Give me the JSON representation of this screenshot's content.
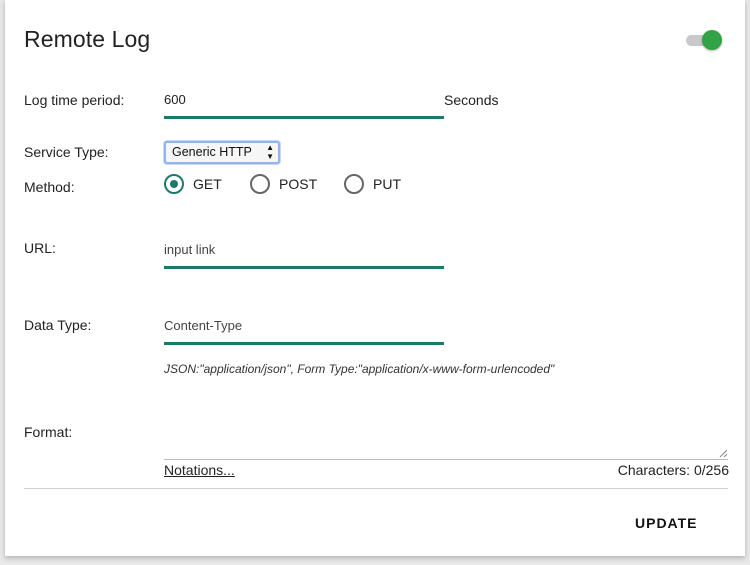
{
  "header": {
    "title": "Remote Log",
    "enabled": true
  },
  "log_period": {
    "label": "Log time period:",
    "value": "600",
    "unit": "Seconds"
  },
  "service": {
    "label": "Service Type:",
    "selected": "Generic HTTP"
  },
  "method": {
    "label": "Method:",
    "options": [
      "GET",
      "POST",
      "PUT"
    ],
    "selected": "GET"
  },
  "url": {
    "label": "URL:",
    "placeholder": "input link",
    "value": ""
  },
  "data_type": {
    "label": "Data Type:",
    "placeholder": "Content-Type",
    "hint": "JSON:\"application/json\", Form Type:\"application/x-www-form-urlencoded\""
  },
  "format": {
    "label": "Format:",
    "value": "",
    "notations_link": "Notations...",
    "char_count": "Characters: 0/256"
  },
  "footer": {
    "update_label": "UPDATE"
  },
  "colors": {
    "accent": "#1e7a68",
    "toggle_on": "#33a145"
  }
}
